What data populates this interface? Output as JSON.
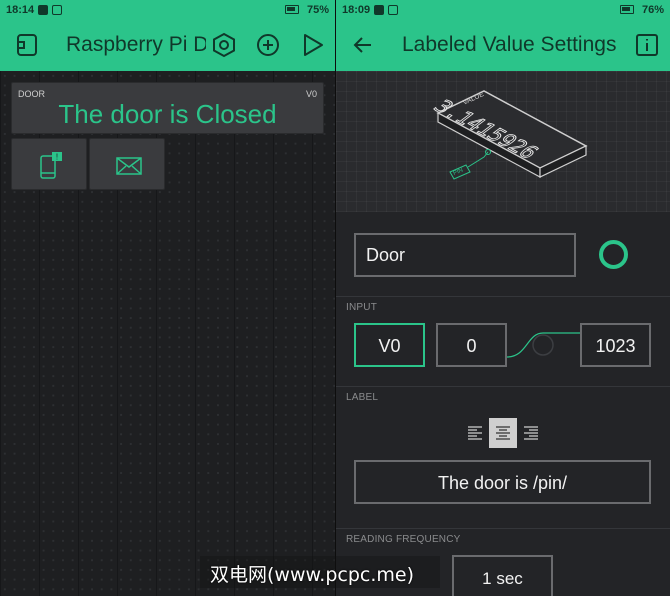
{
  "left": {
    "status": {
      "time": "18:14",
      "battery": "75%"
    },
    "appbar": {
      "title": "Raspberry Pi Do"
    },
    "door_widget": {
      "label": "DOOR",
      "pin": "V0",
      "value": "The door is Closed"
    },
    "colors": {
      "accent": "#2bc48a"
    }
  },
  "right": {
    "status": {
      "time": "18:09",
      "battery": "76%"
    },
    "appbar": {
      "title": "Labeled Value Settings"
    },
    "preview": {
      "value_caption": "VALUE",
      "value_text": "3.1415926",
      "pin_caption": "PIN"
    },
    "name_field": {
      "value": "Door"
    },
    "input": {
      "section_label": "INPUT",
      "pin": "V0",
      "min": "0",
      "max": "1023"
    },
    "label": {
      "section_label": "LABEL",
      "value": "The door is /pin/"
    },
    "reading_frequency": {
      "section_label": "READING FREQUENCY",
      "value": "1 sec"
    }
  },
  "watermark": "双电网(www.pcpc.me)"
}
